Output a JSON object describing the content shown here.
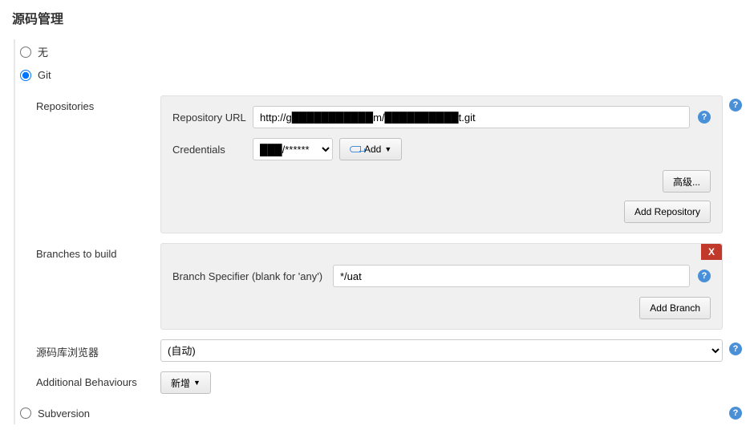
{
  "title": "源码管理",
  "scm": {
    "options": {
      "none": "无",
      "git": "Git",
      "subversion": "Subversion"
    },
    "selected": "git"
  },
  "git": {
    "repositories_label": "Repositories",
    "repository_url_label": "Repository URL",
    "repository_url_value": "http://g███████████m/██████████t.git",
    "credentials_label": "Credentials",
    "credentials_value": "███/******",
    "add_button": "Add",
    "advanced_button": "高级...",
    "add_repository_button": "Add Repository",
    "branches_label": "Branches to build",
    "branch_specifier_label": "Branch Specifier (blank for 'any')",
    "branch_specifier_value": "*/uat",
    "add_branch_button": "Add Branch",
    "close_x": "X",
    "browser_label": "源码库浏览器",
    "browser_value": "(自动)",
    "additional_label": "Additional Behaviours",
    "additional_add_button": "新增"
  }
}
